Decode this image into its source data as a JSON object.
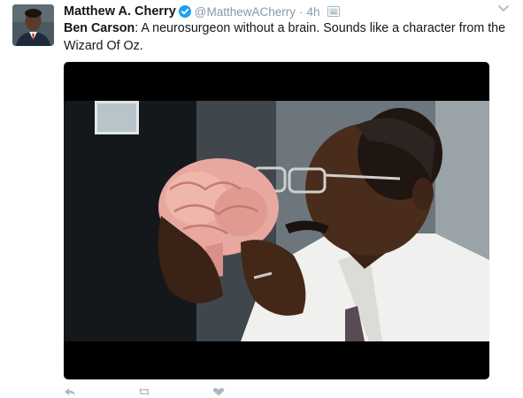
{
  "tweet": {
    "author_name": "Matthew A. Cherry",
    "handle": "@MatthewACherry",
    "separator": "·",
    "time": "4h",
    "text_bold": "Ben Carson",
    "text_rest": ": A neurosurgeon without a brain. Sounds like a character from the Wizard Of Oz.",
    "icons": {
      "verified": "verified-badge-icon",
      "media": "photo-gallery-icon",
      "more": "chevron-down-icon",
      "reply": "reply-icon",
      "retweet": "retweet-icon",
      "like": "heart-icon"
    },
    "colors": {
      "verified": "#1da1f2",
      "muted": "#8899a6",
      "text": "#14171a"
    }
  }
}
